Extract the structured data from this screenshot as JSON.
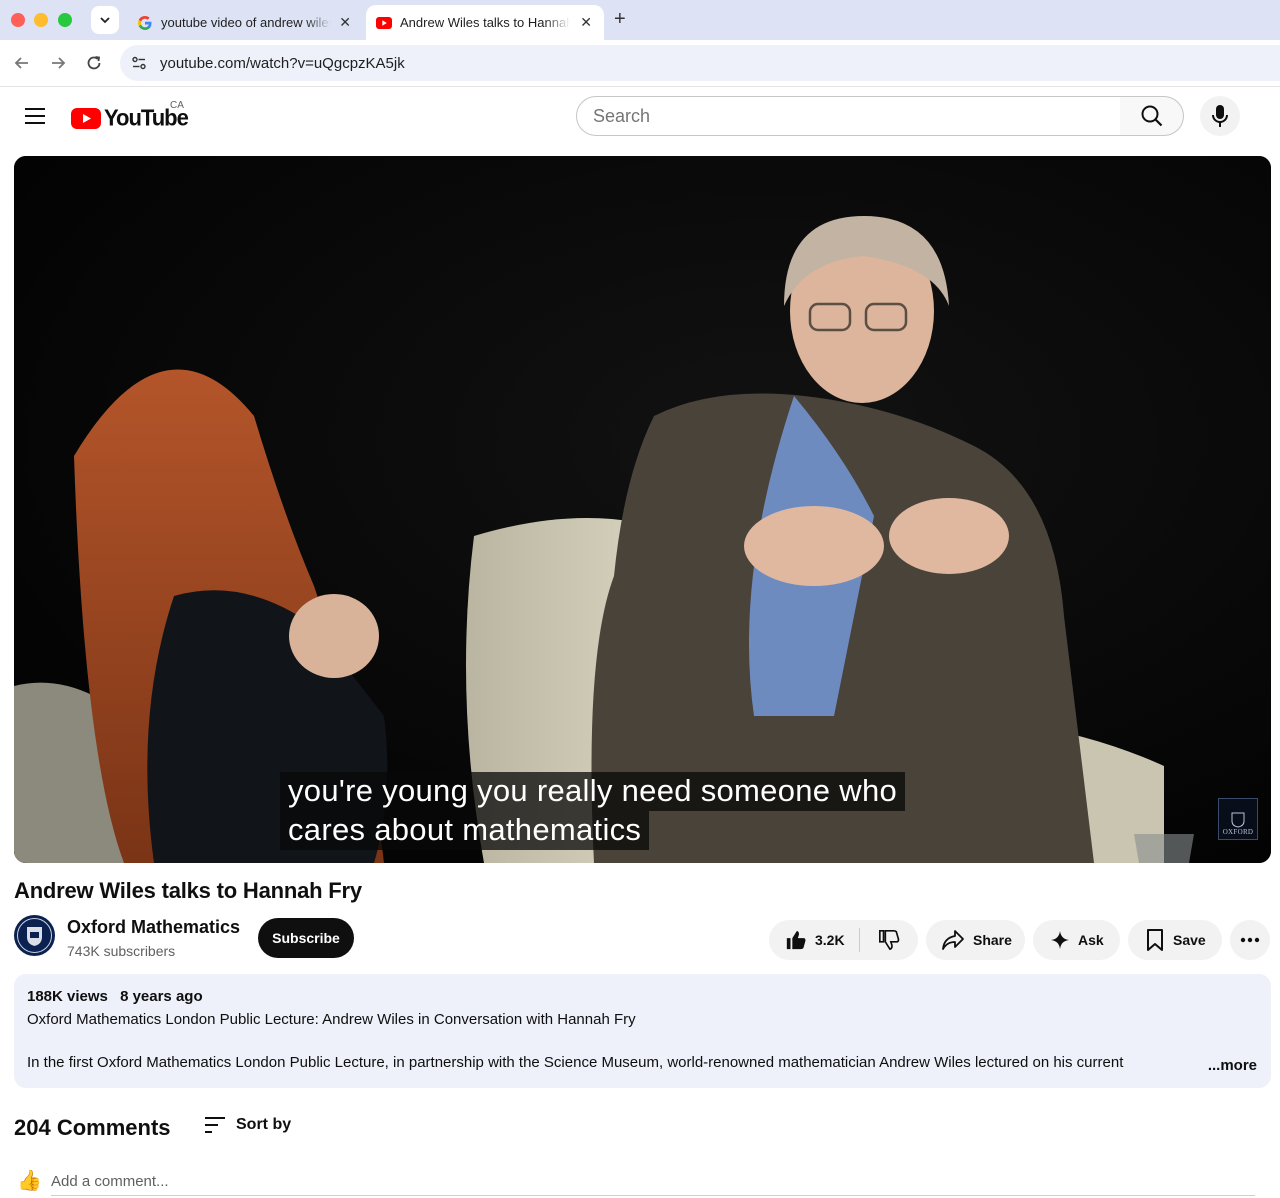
{
  "browser": {
    "tabs": [
      {
        "title": "youtube video of andrew wiles",
        "icon": "google-icon",
        "active": false
      },
      {
        "title": "Andrew Wiles talks to Hannah Fry",
        "icon": "youtube-icon",
        "active": true
      }
    ],
    "url": "youtube.com/watch?v=uQgcpzKA5jk"
  },
  "masthead": {
    "logo_text": "YouTube",
    "country_code": "CA",
    "search_placeholder": "Search"
  },
  "video": {
    "caption_line1": "you're young you really need someone who",
    "caption_line2": "cares about mathematics",
    "watermark": "OXFORD",
    "title": "Andrew Wiles talks to Hannah Fry"
  },
  "channel": {
    "name": "Oxford Mathematics",
    "subscribers": "743K subscribers",
    "subscribe_label": "Subscribe"
  },
  "actions": {
    "likes": "3.2K",
    "share": "Share",
    "ask": "Ask",
    "save": "Save"
  },
  "description": {
    "views": "188K views",
    "age": "8 years ago",
    "line1": "Oxford Mathematics London Public Lecture: Andrew Wiles in Conversation with Hannah Fry",
    "line2": "In the first Oxford Mathematics London Public Lecture, in partnership with the Science Museum, world-renowned mathematician Andrew Wiles lectured on his current",
    "more": "...more"
  },
  "comments": {
    "count_label": "204 Comments",
    "sort_label": "Sort by",
    "add_placeholder": "Add a comment...",
    "emoji": "👍"
  },
  "colors": {
    "youtube_red": "#ff0000",
    "tabbar_bg": "#dde3f4",
    "description_bg": "#eef1fa"
  }
}
